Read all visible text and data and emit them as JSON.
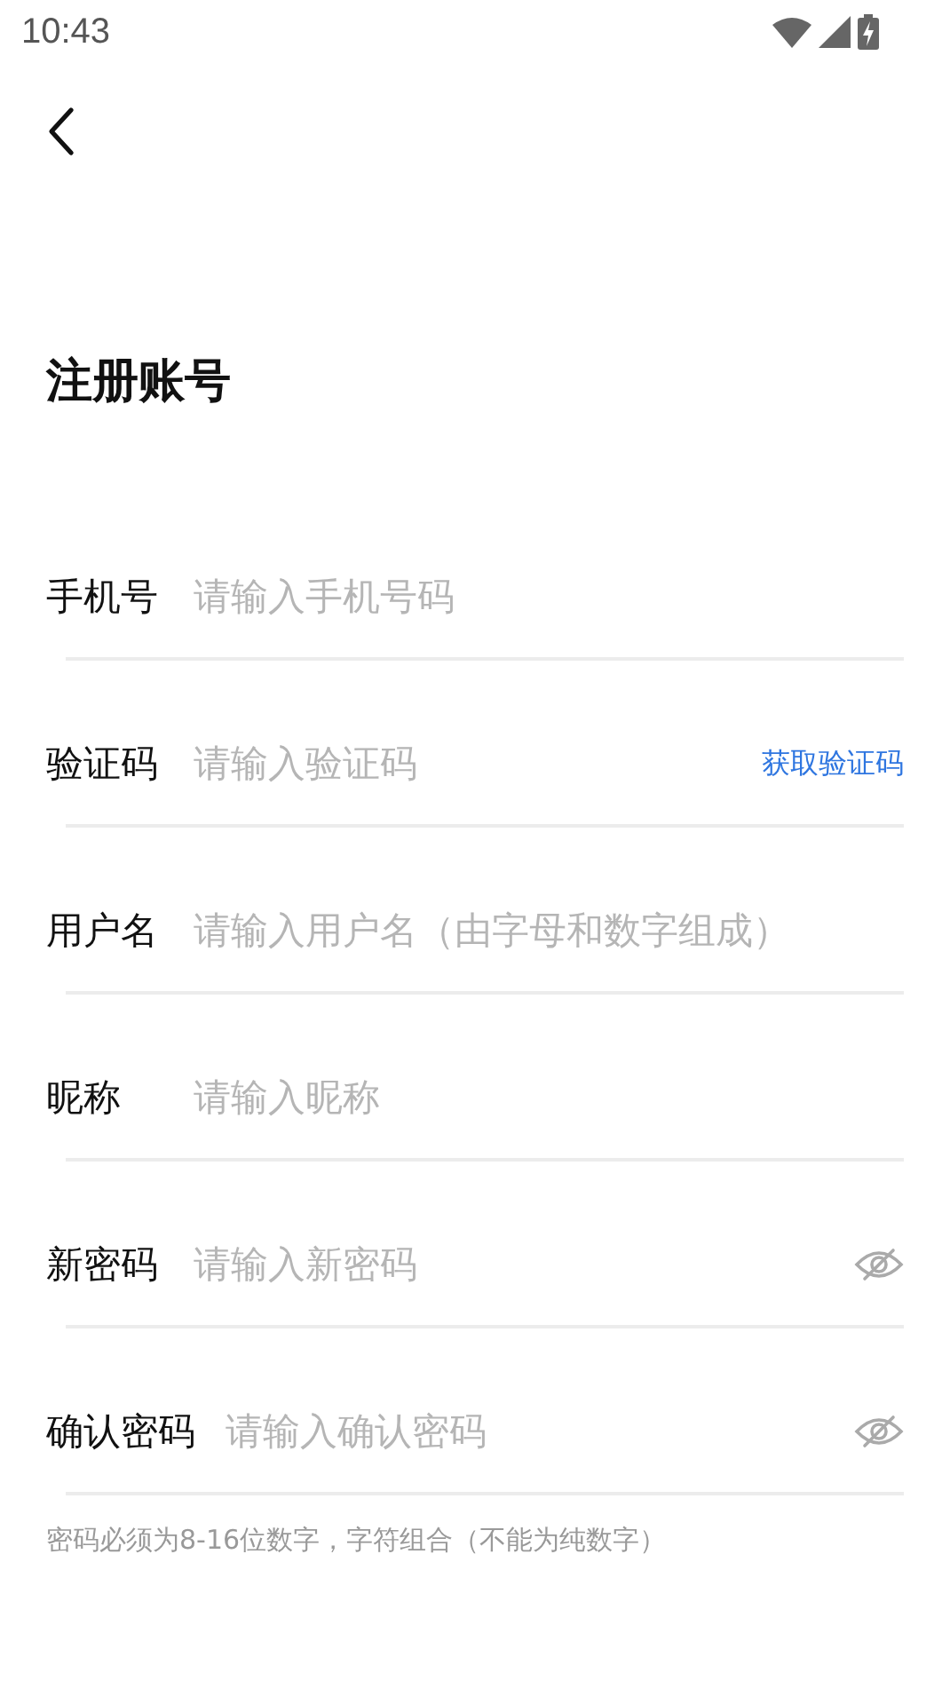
{
  "status_bar": {
    "time": "10:43"
  },
  "title": "注册账号",
  "fields": [
    {
      "kind": "plain",
      "label": "手机号",
      "placeholder": "请输入手机号码"
    },
    {
      "kind": "code",
      "label": "验证码",
      "placeholder": "请输入验证码",
      "action": "获取验证码"
    },
    {
      "kind": "plain",
      "label": "用户名",
      "placeholder": "请输入用户名（由字母和数字组成）"
    },
    {
      "kind": "plain",
      "label": "昵称",
      "placeholder": "请输入昵称"
    },
    {
      "kind": "password",
      "label": "新密码",
      "placeholder": "请输入新密码",
      "visible": false
    },
    {
      "kind": "password",
      "label": "确认密码",
      "placeholder": "请输入确认密码",
      "visible": false
    }
  ],
  "hint": "密码必须为8-16位数字，字符组合（不能为纯数字）"
}
